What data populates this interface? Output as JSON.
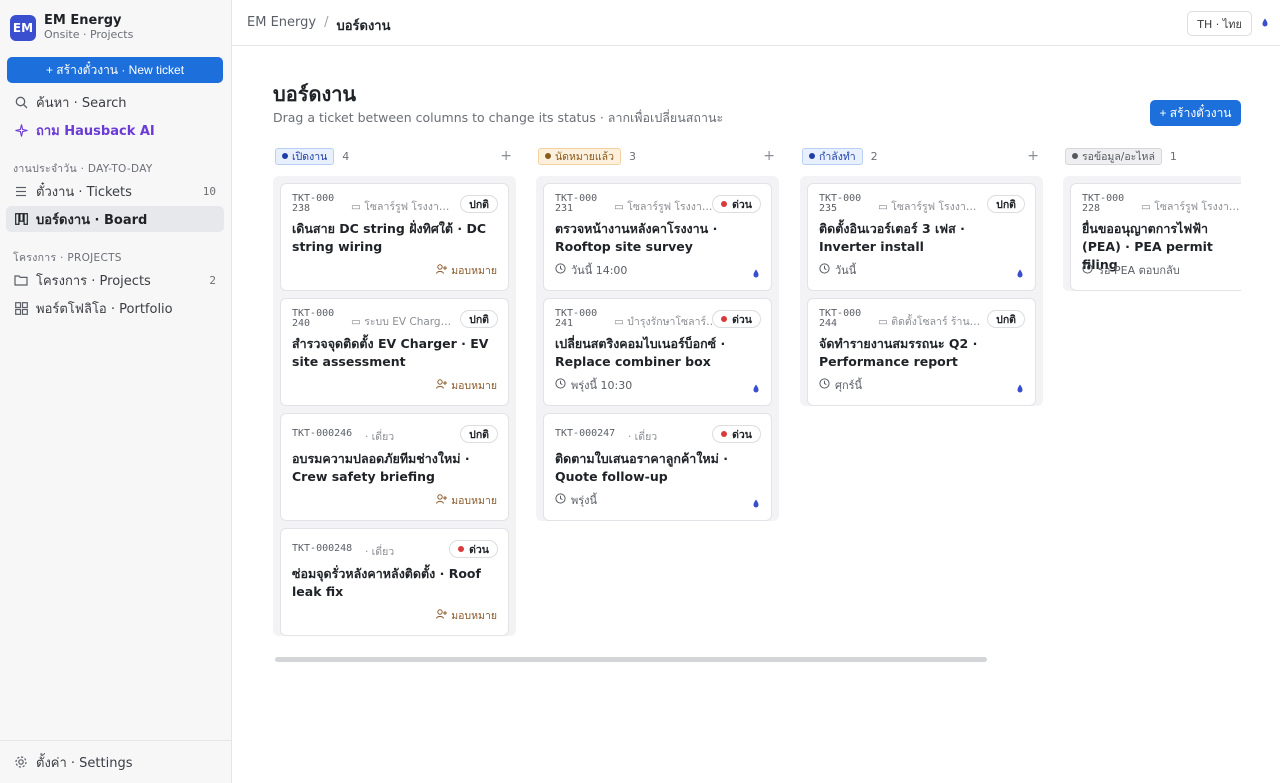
{
  "brand": {
    "logo": "EM",
    "name": "EM Energy",
    "sub": "Onsite · Projects"
  },
  "sidebar": {
    "new_ticket": "+ สร้างตั๋วงาน · New ticket",
    "search": "ค้นหา · Search",
    "ai": "ถาม Hausback AI",
    "section_daily": "งานประจำวัน · DAY-TO-DAY",
    "tickets": {
      "label": "ตั๋วงาน · Tickets",
      "count": "10"
    },
    "board": "บอร์ดงาน · Board",
    "section_projects": "โครงการ · PROJECTS",
    "projects": {
      "label": "โครงการ · Projects",
      "count": "2"
    },
    "portfolio": "พอร์ตโฟลิโอ · Portfolio",
    "settings": "ตั้งค่า · Settings"
  },
  "topbar": {
    "crumb_root": "EM Energy",
    "crumb_sep": "/",
    "crumb_current": "บอร์ดงาน",
    "lang": "TH · ไทย"
  },
  "page": {
    "title": "บอร์ดงาน",
    "subtitle": "Drag a ticket between columns to change its status · ลากเพื่อเปลี่ยนสถานะ",
    "create": "+ สร้างตั๋วงาน"
  },
  "colors": {
    "accent": "#1d6fdc",
    "urgent": "#d93a3a"
  },
  "columns": [
    {
      "label": "เปิดงาน",
      "count": "4",
      "add": "+",
      "cards": [
        {
          "id": "TKT-000238",
          "project": "▭ โซลาร์รูฟ โรงงานสมุทรปราการ",
          "priority": "ปกติ",
          "urgent": false,
          "title": "เดินสาย DC string ฝั่งทิศใต้ · DC string wiring",
          "footer": "มอบหมาย",
          "footer_type": "assign"
        },
        {
          "id": "TKT-000240",
          "project": "▭ ระบบ EV Charger คอนโด",
          "priority": "ปกติ",
          "urgent": false,
          "title": "สำรวจจุดติดตั้ง EV Charger · EV site assessment",
          "footer": "มอบหมาย",
          "footer_type": "assign"
        },
        {
          "id": "TKT-000246",
          "project": "· เดี่ยว",
          "priority": "ปกติ",
          "urgent": false,
          "title": "อบรมความปลอดภัยทีมช่างใหม่ · Crew safety briefing",
          "footer": "มอบหมาย",
          "footer_type": "assign"
        },
        {
          "id": "TKT-000248",
          "project": "· เดี่ยว",
          "priority": "ด่วน",
          "urgent": true,
          "title": "ซ่อมจุดรั่วหลังคาหลังติดตั้ง · Roof leak fix",
          "footer": "มอบหมาย",
          "footer_type": "assign"
        }
      ]
    },
    {
      "label": "นัดหมายแล้ว",
      "count": "3",
      "add": "+",
      "cards": [
        {
          "id": "TKT-000231",
          "project": "▭ โซลาร์รูฟ โรงงานสมุทรปราการ",
          "priority": "ด่วน",
          "urgent": true,
          "title": "ตรวจหน้างานหลังคาโรงงาน · Rooftop site survey",
          "footer": "วันนี้ 14:00",
          "footer_type": "time"
        },
        {
          "id": "TKT-000241",
          "project": "▭ บำรุงรักษาโซลาร์ โรงแรม",
          "priority": "ด่วน",
          "urgent": true,
          "title": "เปลี่ยนสตริงคอมไบเนอร์บ็อกซ์ · Replace combiner box",
          "footer": "พรุ่งนี้ 10:30",
          "footer_type": "time"
        },
        {
          "id": "TKT-000247",
          "project": "· เดี่ยว",
          "priority": "ด่วน",
          "urgent": true,
          "title": "ติดตามใบเสนอราคาลูกค้าใหม่ · Quote follow-up",
          "footer": "พรุ่งนี้",
          "footer_type": "time"
        }
      ]
    },
    {
      "label": "กำลังทำ",
      "count": "2",
      "add": "+",
      "cards": [
        {
          "id": "TKT-000235",
          "project": "▭ โซลาร์รูฟ โรงงานสมุทรปราการ",
          "priority": "ปกติ",
          "urgent": false,
          "title": "ติดตั้งอินเวอร์เตอร์ 3 เฟส · Inverter install",
          "footer": "วันนี้",
          "footer_type": "time"
        },
        {
          "id": "TKT-000244",
          "project": "▭ ติดตั้งโซลาร์ ร้านโกดัง",
          "priority": "ปกติ",
          "urgent": false,
          "title": "จัดทำรายงานสมรรถนะ Q2 · Performance report",
          "footer": "ศุกร์นี้",
          "footer_type": "time"
        }
      ]
    },
    {
      "label": "รอข้อมูล/อะไหล่",
      "count": "1",
      "add": "",
      "cards": [
        {
          "id": "TKT-000228",
          "project": "▭ โซลาร์รูฟ โรงงานสมุทรปราการ",
          "priority": "",
          "urgent": false,
          "title": "ยื่นขออนุญาตการไฟฟ้า (PEA) · PEA permit filing",
          "footer": "รอ PEA ตอบกลับ",
          "footer_type": "time"
        }
      ]
    }
  ]
}
